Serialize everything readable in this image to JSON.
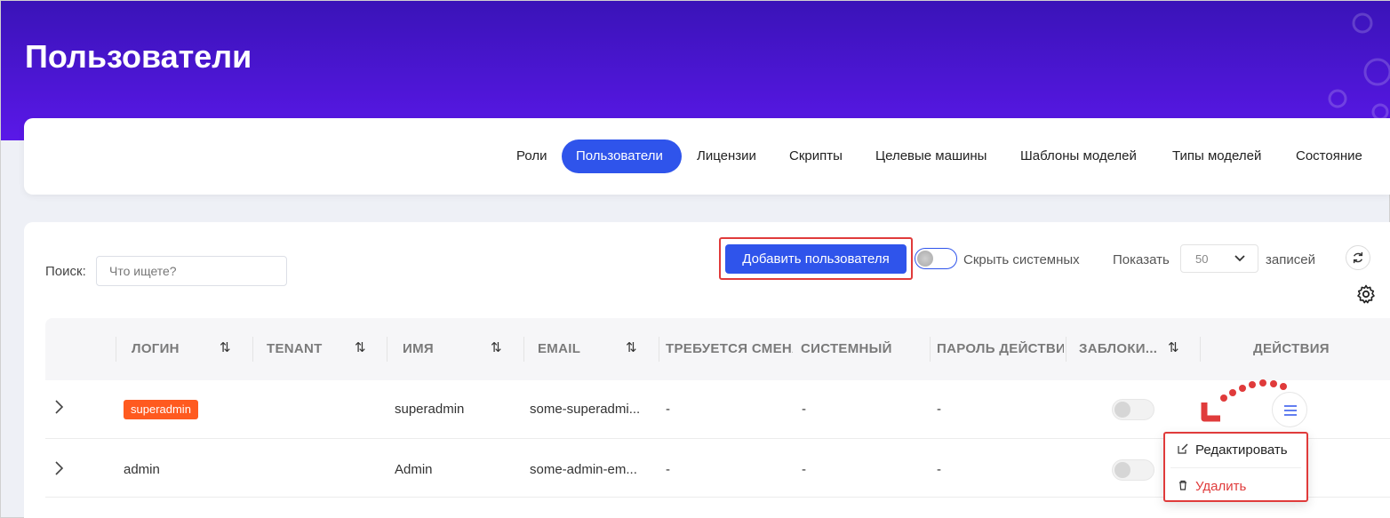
{
  "page": {
    "title": "Пользователи"
  },
  "tabs": [
    {
      "label": "Роли"
    },
    {
      "label": "Пользователи"
    },
    {
      "label": "Лицензии"
    },
    {
      "label": "Скрипты"
    },
    {
      "label": "Целевые машины"
    },
    {
      "label": "Шаблоны моделей"
    },
    {
      "label": "Типы моделей"
    },
    {
      "label": "Состояние"
    }
  ],
  "active_tab": "Пользователи",
  "toolbar": {
    "search_label": "Поиск:",
    "search_placeholder": "Что ищете?",
    "search_value": "",
    "add_button": "Добавить пользователя",
    "hide_system_label": "Скрыть системных",
    "show_label": "Показать",
    "page_size": "50",
    "records_label": "записей"
  },
  "table": {
    "columns": [
      "ЛОГИН",
      "TENANT",
      "ИМЯ",
      "EMAIL",
      "ТРЕБУЕТСЯ СМЕНА",
      "СИСТЕМНЫЙ",
      "ПАРОЛЬ ДЕЙСТВИ",
      "ЗАБЛОКИ...",
      "ДЕЙСТВИЯ"
    ],
    "rows": [
      {
        "login": "superadmin",
        "login_badge": true,
        "tenant": "",
        "name": "superadmin",
        "email": "some-superadmi...",
        "change_required": "-",
        "system": "-",
        "password_valid": "-",
        "blocked": false
      },
      {
        "login": "admin",
        "login_badge": false,
        "tenant": "",
        "name": "Admin",
        "email": "some-admin-em...",
        "change_required": "-",
        "system": "-",
        "password_valid": "-",
        "blocked": false
      }
    ]
  },
  "actions_menu": {
    "edit": "Редактировать",
    "delete": "Удалить"
  },
  "icons": {
    "sort": "sort-arrows-icon",
    "expand": "chevron-right-icon",
    "refresh": "refresh-icon",
    "settings": "gear-icon",
    "menu": "hamburger-icon",
    "edit": "edit-icon",
    "delete": "trash-icon",
    "dropdown": "chevron-down-icon"
  },
  "colors": {
    "header_gradient_top": "#3a13b8",
    "header_gradient_bottom": "#5a18e8",
    "primary": "#2f54eb",
    "badge": "#ff5a1f",
    "danger": "#e03b3b"
  }
}
